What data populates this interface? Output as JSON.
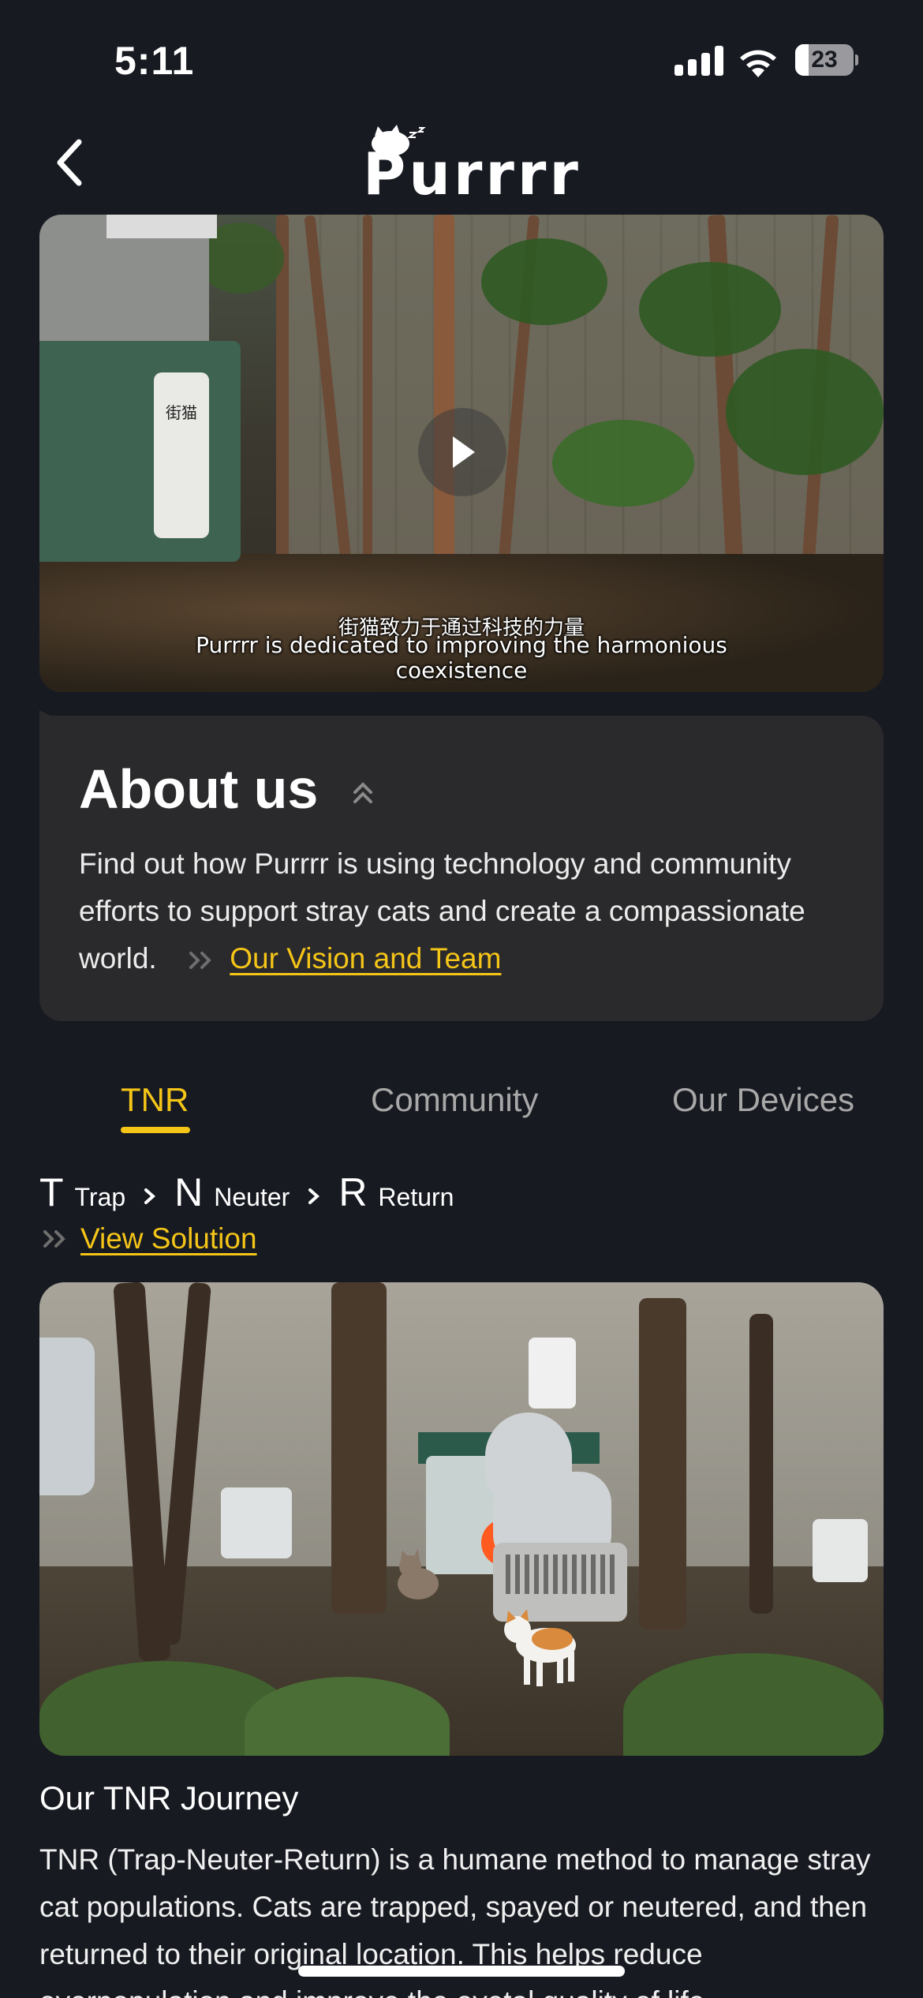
{
  "status_bar": {
    "time": "5:11",
    "battery_level": "23",
    "battery_fraction": 0.23
  },
  "nav": {
    "logo_text": "Purrrr"
  },
  "video": {
    "device_label": "街猫",
    "subtitle_zh": "街猫致力于通过科技的力量",
    "subtitle_en": "Purrrr is dedicated to improving the harmonious coexistence"
  },
  "about": {
    "title": "About us",
    "description": "Find out how Purrrr is using technology and community efforts to support stray cats and create a compassionate world.",
    "link_label": "Our Vision and Team"
  },
  "tabs": [
    {
      "label": "TNR",
      "active": true
    },
    {
      "label": "Community",
      "active": false
    },
    {
      "label": "Our Devices",
      "active": false
    }
  ],
  "tnr_steps": [
    {
      "letter": "T",
      "word": "Trap"
    },
    {
      "letter": "N",
      "word": "Neuter"
    },
    {
      "letter": "R",
      "word": "Return"
    }
  ],
  "view_solution_label": "View Solution",
  "journey": {
    "title": "Our TNR Journey",
    "text": "TNR (Trap-Neuter-Return) is a humane method to manage stray cat populations. Cats are trapped, spayed or neutered, and then returned to their original location. This helps reduce overpopulation and improve the ovetal quality of life"
  },
  "colors": {
    "background": "#171a21",
    "card": "#2a2a2c",
    "accent": "#f5c518",
    "muted_text": "#a8a8a8"
  },
  "icons": [
    "signal-icon",
    "wifi-icon",
    "battery-icon",
    "back-chevron-icon",
    "cat-logo-icon",
    "play-icon",
    "collapse-chevron-icon",
    "double-chevron-icon",
    "step-chevron-icon"
  ]
}
